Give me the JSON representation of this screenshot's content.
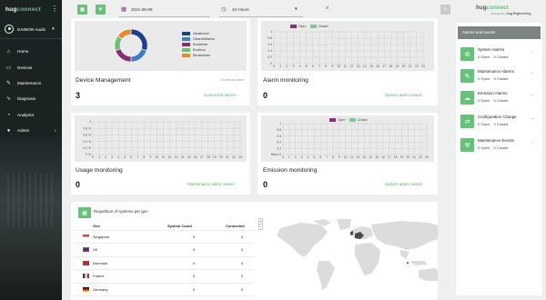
{
  "sidebar": {
    "logo_prefix": "hug",
    "logo_suffix": "connect",
    "user": "DAIMON Audio",
    "items": [
      {
        "label": "Home",
        "icon": "home-icon"
      },
      {
        "label": "Devices",
        "icon": "devices-icon"
      },
      {
        "label": "Maintenance",
        "icon": "wrench-icon"
      },
      {
        "label": "Diagnosis",
        "icon": "diagnosis-icon"
      },
      {
        "label": "Analytics",
        "icon": "analytics-icon"
      },
      {
        "label": "Admin",
        "icon": "admin-icon"
      }
    ]
  },
  "toolbar": {
    "date": "2021-06-08",
    "range": "24 Hours"
  },
  "brand": {
    "prefix": "hug",
    "suffix": "connect",
    "powered": "Powered by",
    "company": "hug Engineering"
  },
  "device_mgmt": {
    "title": "Device Management",
    "value": "3",
    "link": "Connected device",
    "note": "4/0 devices listed",
    "legend": [
      {
        "label": "Nautichiver",
        "color": "#1e3f8c"
      },
      {
        "label": "ClearAirMarine",
        "color": "#3a7fc4"
      },
      {
        "label": "Ecotekhal",
        "color": "#8a2f6e"
      },
      {
        "label": "Ecotinox",
        "color": "#68c17a"
      },
      {
        "label": "Strubichiam",
        "color": "#e38b2c"
      }
    ]
  },
  "colors": {
    "open": "#8a2f7e",
    "closed": "#7fc98f",
    "accent": "#68c17a"
  },
  "alarm_monitoring": {
    "title": "Alarm monitoring",
    "value": "0",
    "link": "System alarm raised",
    "legend_open": "Open",
    "legend_closed": "Closed"
  },
  "usage": {
    "title": "Usage monitoring",
    "value": "0",
    "link": "Maintenance alarm raised"
  },
  "emission": {
    "title": "Emission monitoring",
    "value": "0",
    "link": "System alarm raised",
    "legend_open": "Open",
    "legend_closed": "Closed"
  },
  "alarms_panel": {
    "title": "Alarms and events",
    "items": [
      {
        "name": "System Alarms",
        "open": "0 Open",
        "closed": "0 Closed",
        "icon": "system-alarm-icon"
      },
      {
        "name": "Maintenance Alarms",
        "open": "0 Open",
        "closed": "0 Closed",
        "icon": "maintenance-alarm-icon"
      },
      {
        "name": "Emission Alarms",
        "open": "0 Open",
        "closed": "0 Closed",
        "icon": "emission-alarm-icon"
      },
      {
        "name": "Configuration Change",
        "open": "0 Open",
        "closed": "0 Closed",
        "icon": "configuration-icon"
      },
      {
        "name": "Maintenance Events",
        "open": "0 Open",
        "closed": "0 Closed",
        "icon": "maintenance-events-icon"
      }
    ]
  },
  "geo": {
    "title": "Repartition of systems per geo",
    "headers": [
      "Geo",
      "System Count",
      "Connected"
    ],
    "rows": [
      {
        "geo": "Singapore",
        "count": "0",
        "connected": "0"
      },
      {
        "geo": "UK",
        "count": "0",
        "connected": "0"
      },
      {
        "geo": "Denmark",
        "count": "0",
        "connected": "0"
      },
      {
        "geo": "France",
        "count": "0",
        "connected": "0"
      },
      {
        "geo": "Germany",
        "count": "0",
        "connected": "0"
      }
    ],
    "zoom_in": "+",
    "zoom_out": "−"
  },
  "chart_data": [
    {
      "type": "pie",
      "title": "",
      "categories": [
        "Nautichiver",
        "ClearAirMarine",
        "Ecotekhal",
        "Ecotinox",
        "Strubichiam"
      ],
      "values": [
        30,
        20,
        20,
        15,
        15
      ]
    },
    {
      "type": "bar",
      "title": "",
      "y_ticks": [
        "1",
        "0.8",
        "0.6",
        "0.4",
        "0.2",
        "0"
      ],
      "x_ticks": [
        "0",
        "1",
        "2",
        "3",
        "4",
        "5",
        "6",
        "7",
        "8",
        "9",
        "10",
        "11",
        "12",
        "13",
        "14",
        "15",
        "16",
        "17",
        "18",
        "19",
        "20",
        "21",
        "22",
        "23"
      ],
      "series": [
        {
          "name": "Open",
          "values": []
        },
        {
          "name": "Closed",
          "values": []
        }
      ]
    },
    {
      "type": "bar",
      "title": "",
      "y_ticks": [
        "1",
        "0.8 %",
        "0.6 %",
        "0.4 %",
        "0.2 %",
        "0 %"
      ],
      "x_ticks": [
        "0",
        "1",
        "2",
        "3",
        "4",
        "5",
        "6",
        "7",
        "8",
        "9",
        "10",
        "11",
        "12",
        "13",
        "14",
        "15",
        "16",
        "17",
        "18",
        "19",
        "20",
        "21",
        "22",
        "23"
      ],
      "series": []
    },
    {
      "type": "bar",
      "title": "",
      "y_ticks": [
        "1",
        "0.8",
        "0.6",
        "0.4",
        "0.2",
        "Minor 0"
      ],
      "x_ticks": [
        "0",
        "1",
        "2",
        "3",
        "4",
        "5",
        "6",
        "7",
        "8",
        "9",
        "10",
        "11",
        "12",
        "13",
        "14",
        "15",
        "16",
        "17",
        "18",
        "19",
        "20",
        "21",
        "22",
        "23"
      ],
      "series": [
        {
          "name": "Open",
          "values": []
        },
        {
          "name": "Closed",
          "values": []
        }
      ]
    }
  ]
}
